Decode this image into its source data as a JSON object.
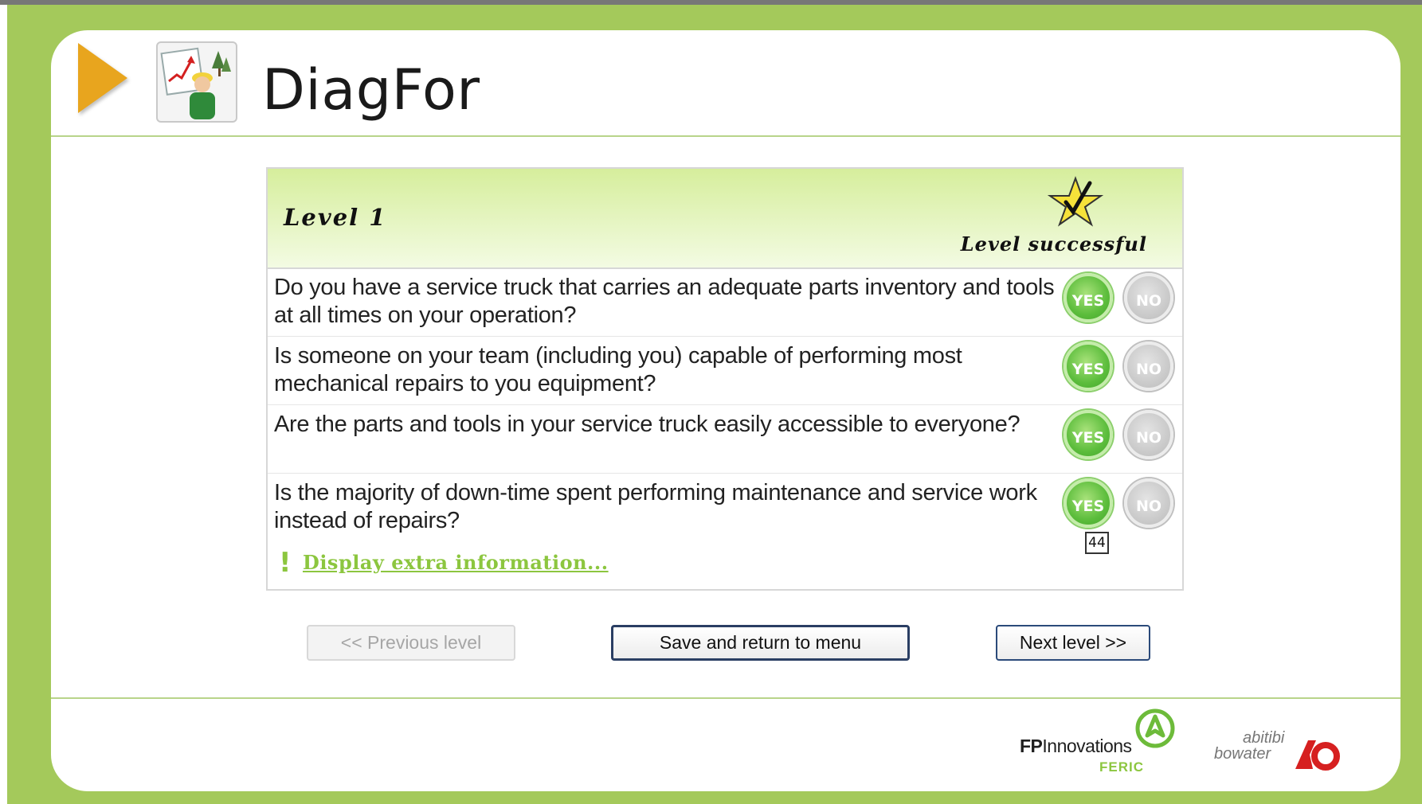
{
  "app": {
    "title": "DiagFor"
  },
  "level": {
    "title": "Level 1",
    "status": "Level successful"
  },
  "questions": [
    {
      "text": "Do you have a service truck that carries an adequate parts inventory and tools at all times on your operation?",
      "yes_label": "YES",
      "no_label": "NO"
    },
    {
      "text": "Is someone on your team (including you) capable of performing most mechanical repairs to you equipment?",
      "yes_label": "YES",
      "no_label": "NO"
    },
    {
      "text": "Are the parts and tools in your service truck easily accessible to everyone?",
      "yes_label": "YES",
      "no_label": "NO"
    },
    {
      "text": "Is the majority of down-time spent performing maintenance and service work instead of repairs?",
      "yes_label": "YES",
      "no_label": "NO"
    }
  ],
  "badge": {
    "count": "44"
  },
  "extra_info": {
    "link_label": "Display extra information..."
  },
  "nav": {
    "previous_label": "<< Previous level",
    "save_label": "Save and return to menu",
    "next_label": "Next level >>"
  },
  "footer": {
    "fpi_name_bold": "FP",
    "fpi_name_rest": "Innovations",
    "fpi_sub": "FERIC",
    "ab_line1": "abitibi",
    "ab_line2": "bowater"
  },
  "colors": {
    "frame": "#a4c95b",
    "accent_green": "#8cc63f",
    "play_orange": "#e8a51e",
    "yes_green": "#5cbd3c",
    "no_gray": "#c7c7c7",
    "button_border": "#2a3e63"
  },
  "icons": {
    "play": "play-triangle-icon",
    "app_logo": "forestry-worker-chart-icon",
    "star": "star-check-icon",
    "exclamation": "exclamation-icon"
  }
}
